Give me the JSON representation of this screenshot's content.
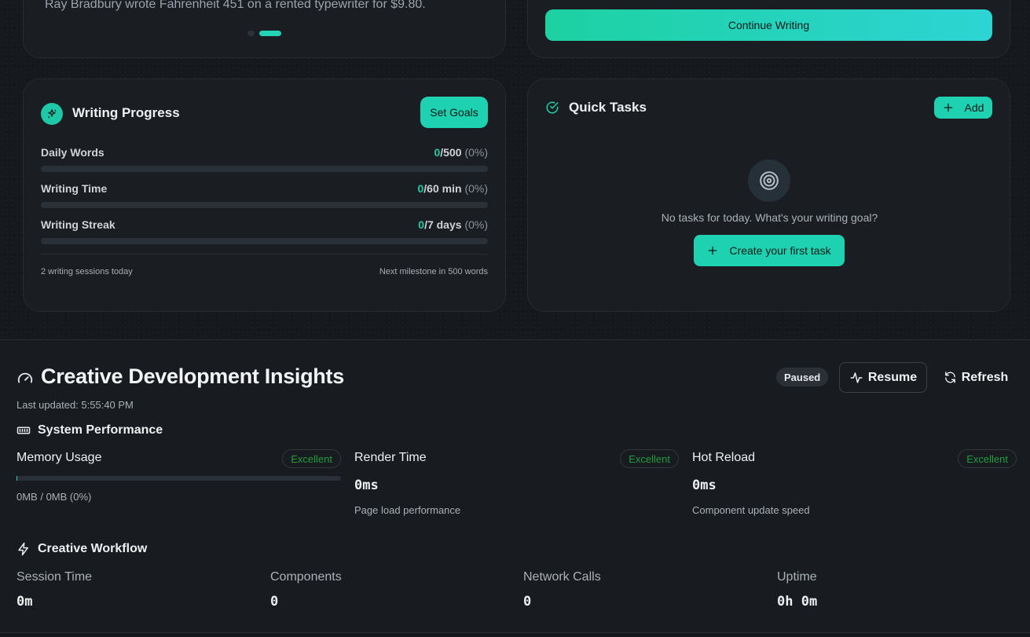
{
  "fact_card": {
    "text": "Ray Bradbury wrote Fahrenheit 451 on a rented typewriter for $9.80."
  },
  "continue_card": {
    "button_label": "Continue Writing"
  },
  "writing_progress": {
    "title": "Writing Progress",
    "set_goals_label": "Set Goals",
    "metrics": [
      {
        "label": "Daily Words",
        "current": "0",
        "target": "/500",
        "percent": "(0%)"
      },
      {
        "label": "Writing Time",
        "current": "0",
        "target": "/60 min",
        "percent": "(0%)"
      },
      {
        "label": "Writing Streak",
        "current": "0",
        "target": "/7 days",
        "percent": "(0%)"
      }
    ],
    "sessions_text": "2 writing sessions today",
    "milestone_text": "Next milestone in 500 words"
  },
  "quick_tasks": {
    "title": "Quick Tasks",
    "add_label": "Add",
    "empty_text": "No tasks for today. What's your writing goal?",
    "create_label": "Create your first task"
  },
  "insights": {
    "title": "Creative Development Insights",
    "status_badge": "Paused",
    "resume_label": "Resume",
    "refresh_label": "Refresh",
    "last_updated": "Last updated: 5:55:40 PM",
    "performance": {
      "title": "System Performance",
      "memory": {
        "name": "Memory Usage",
        "badge": "Excellent",
        "text": "0MB / 0MB (0%)"
      },
      "render": {
        "name": "Render Time",
        "badge": "Excellent",
        "value": "0ms",
        "desc": "Page load performance"
      },
      "reload": {
        "name": "Hot Reload",
        "badge": "Excellent",
        "value": "0ms",
        "desc": "Component update speed"
      }
    },
    "workflow": {
      "title": "Creative Workflow",
      "items": [
        {
          "name": "Session Time",
          "value": "0m"
        },
        {
          "name": "Components",
          "value": "0"
        },
        {
          "name": "Network Calls",
          "value": "0"
        },
        {
          "name": "Uptime",
          "value": "0h 0m"
        }
      ]
    }
  },
  "colors": {
    "accent": "#1ed1b0",
    "excellent": "#1f9d3f",
    "background": "#15181c"
  }
}
